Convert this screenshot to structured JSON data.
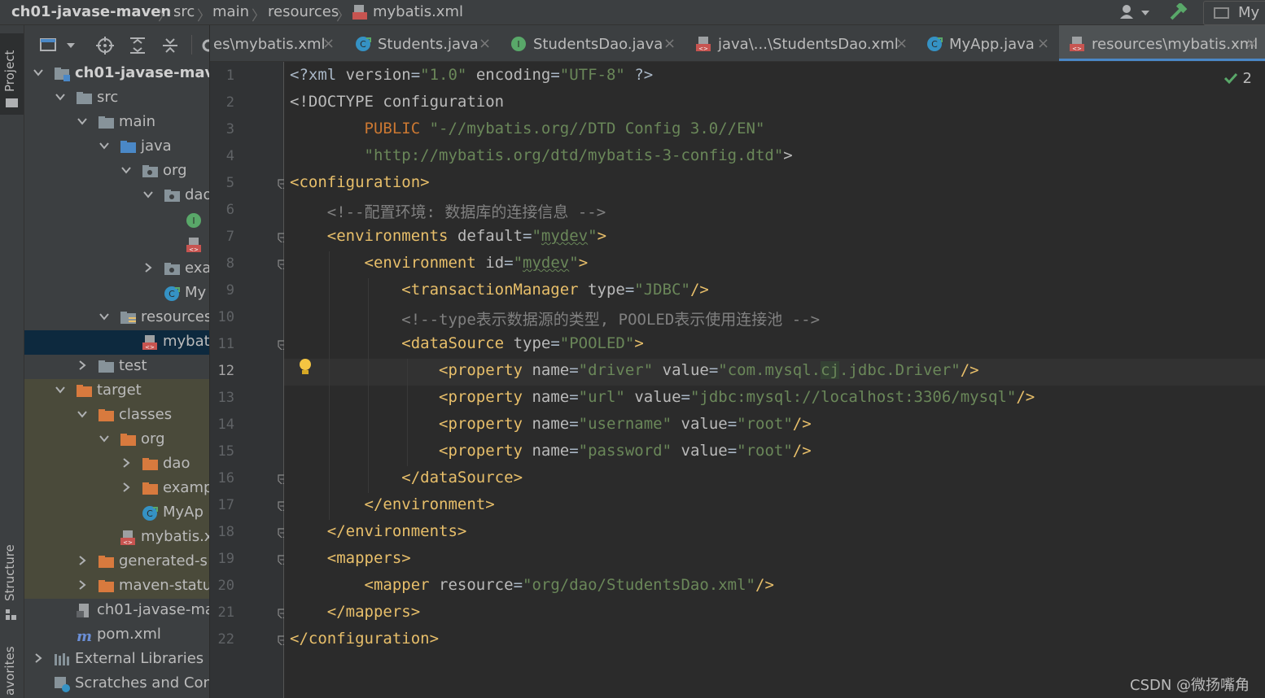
{
  "breadcrumb": [
    "ch01-javase-maven",
    "src",
    "main",
    "resources",
    "mybatis.xml"
  ],
  "toolbar_right": {
    "run_config_label": "My"
  },
  "left_stripe": {
    "project": "Project",
    "structure": "Structure",
    "favorites": "avorites"
  },
  "tree": [
    {
      "label": "ch01-javase-mave",
      "icon": "module-folder-icon",
      "expanded": true,
      "bold": true
    },
    {
      "label": "src",
      "icon": "folder-icon",
      "expanded": true
    },
    {
      "label": "main",
      "icon": "folder-icon",
      "expanded": true
    },
    {
      "label": "java",
      "icon": "source-folder-icon",
      "expanded": true
    },
    {
      "label": "org",
      "icon": "package-icon",
      "expanded": true
    },
    {
      "label": "dao",
      "icon": "package-icon",
      "expanded": true
    },
    {
      "label": "",
      "icon": "interface-icon"
    },
    {
      "label": "",
      "icon": "xml-file-icon"
    },
    {
      "label": "exa",
      "icon": "package-icon",
      "expanded": false
    },
    {
      "label": "My",
      "icon": "class-icon"
    },
    {
      "label": "resources",
      "icon": "resources-folder-icon",
      "expanded": true
    },
    {
      "label": "mybat",
      "icon": "xml-file-icon"
    },
    {
      "label": "test",
      "icon": "folder-icon",
      "expanded": false
    },
    {
      "label": "target",
      "icon": "excluded-folder-icon",
      "expanded": true
    },
    {
      "label": "classes",
      "icon": "excluded-folder-icon",
      "expanded": true
    },
    {
      "label": "org",
      "icon": "excluded-folder-icon",
      "expanded": true
    },
    {
      "label": "dao",
      "icon": "excluded-folder-icon",
      "expanded": false
    },
    {
      "label": "examp",
      "icon": "excluded-folder-icon",
      "expanded": false
    },
    {
      "label": "MyAp",
      "icon": "class-icon"
    },
    {
      "label": "mybatis.x",
      "icon": "xml-file-icon"
    },
    {
      "label": "generated-s",
      "icon": "excluded-folder-icon",
      "expanded": false
    },
    {
      "label": "maven-statu",
      "icon": "excluded-folder-icon",
      "expanded": false
    },
    {
      "label": "ch01-javase-ma",
      "icon": "iml-file-icon"
    },
    {
      "label": "pom.xml",
      "icon": "maven-icon"
    },
    {
      "label": "External Libraries",
      "icon": "libraries-icon",
      "expanded": false
    },
    {
      "label": "Scratches and Cons",
      "icon": "scratches-icon"
    }
  ],
  "tabs": [
    {
      "label": "es\\mybatis.xml",
      "icon": "none"
    },
    {
      "label": "Students.java",
      "icon": "class-icon"
    },
    {
      "label": "StudentsDao.java",
      "icon": "interface-icon"
    },
    {
      "label": "java\\...\\StudentsDao.xml",
      "icon": "xml-file-icon"
    },
    {
      "label": "MyApp.java",
      "icon": "class-icon"
    },
    {
      "label": "resources\\mybatis.xml",
      "icon": "xml-file-icon",
      "active": true
    }
  ],
  "editor": {
    "inspection_count": "2",
    "current_line": 12,
    "line_numbers": [
      "1",
      "2",
      "3",
      "4",
      "5",
      "6",
      "7",
      "8",
      "9",
      "10",
      "11",
      "12",
      "13",
      "14",
      "15",
      "16",
      "17",
      "18",
      "19",
      "20",
      "21",
      "22"
    ],
    "lines": [
      "<?xml version=\"1.0\" encoding=\"UTF-8\" ?>",
      "<!DOCTYPE configuration",
      "        PUBLIC \"-//mybatis.org//DTD Config 3.0//EN\"",
      "        \"http://mybatis.org/dtd/mybatis-3-config.dtd\">",
      "<configuration>",
      "    <!--配置环境: 数据库的连接信息 -->",
      "    <environments default=\"mydev\">",
      "        <environment id=\"mydev\">",
      "            <transactionManager type=\"JDBC\"/>",
      "            <!--type表示数据源的类型, POOLED表示使用连接池 -->",
      "            <dataSource type=\"POOLED\">",
      "                <property name=\"driver\" value=\"com.mysql.cj.jdbc.Driver\"/>",
      "                <property name=\"url\" value=\"jdbc:mysql://localhost:3306/mysql\"/>",
      "                <property name=\"username\" value=\"root\"/>",
      "                <property name=\"password\" value=\"root\"/>",
      "            </dataSource>",
      "        </environment>",
      "    </environments>",
      "    <mappers>",
      "        <mapper resource=\"org/dao/StudentsDao.xml\"/>",
      "    </mappers>",
      "</configuration>"
    ]
  },
  "watermark": "CSDN @微扬嘴角",
  "colors": {
    "tag": "#e8bf6a",
    "attr": "#bababa",
    "value": "#6a8759",
    "comment": "#808080",
    "keyword": "#cc7832",
    "selection": "#0d293e",
    "accent": "#4a88c7"
  }
}
